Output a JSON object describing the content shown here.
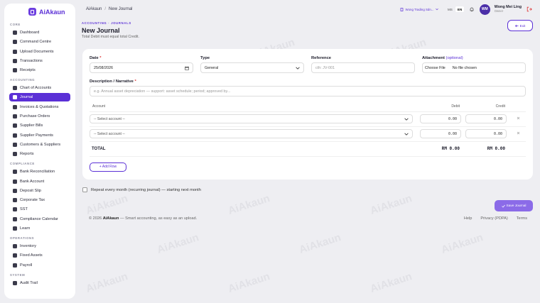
{
  "app": {
    "name": "AiAkaun",
    "watermark": "AiAkaun"
  },
  "sidebar": {
    "sections": [
      {
        "title": "CORE",
        "items": [
          {
            "label": "Dashboard",
            "icon": "dashboard-icon"
          },
          {
            "label": "Command Centre",
            "icon": "command-icon"
          },
          {
            "label": "Upload Documents",
            "icon": "upload-icon"
          },
          {
            "label": "Transactions",
            "icon": "transactions-icon"
          },
          {
            "label": "Receipts",
            "icon": "receipt-icon"
          }
        ]
      },
      {
        "title": "ACCOUNTING",
        "items": [
          {
            "label": "Chart of Accounts",
            "icon": "bar-chart-icon"
          },
          {
            "label": "Journal",
            "icon": "journal-icon",
            "active": true
          },
          {
            "label": "Invoices & Quotations",
            "icon": "invoice-icon"
          },
          {
            "label": "Purchase Orders",
            "icon": "cart-icon"
          },
          {
            "label": "Supplier Bills",
            "icon": "bill-icon"
          },
          {
            "label": "Supplier Payments",
            "icon": "payment-icon"
          },
          {
            "label": "Customers & Suppliers",
            "icon": "people-icon"
          },
          {
            "label": "Reports",
            "icon": "report-icon"
          }
        ]
      },
      {
        "title": "COMPLIANCE",
        "items": [
          {
            "label": "Bank Reconciliation",
            "icon": "check-icon"
          },
          {
            "label": "Bank Account",
            "icon": "bank-icon"
          },
          {
            "label": "Deposit Slip",
            "icon": "deposit-icon"
          },
          {
            "label": "Corporate Tax",
            "icon": "tax-icon"
          },
          {
            "label": "SST",
            "icon": "sst-icon"
          },
          {
            "label": "Compliance Calendar",
            "icon": "calendar-icon"
          },
          {
            "label": "Learn",
            "icon": "info-icon"
          }
        ]
      },
      {
        "title": "OPERATIONS",
        "items": [
          {
            "label": "Inventory",
            "icon": "box-icon"
          },
          {
            "label": "Fixed Assets",
            "icon": "asset-icon"
          },
          {
            "label": "Payroll",
            "icon": "payroll-icon"
          }
        ]
      },
      {
        "title": "SYSTEM",
        "items": [
          {
            "label": "Audit Trail",
            "icon": "audit-icon"
          }
        ]
      }
    ]
  },
  "topbar": {
    "breadcrumb_root": "AiAkaun",
    "breadcrumb_sep": "/",
    "breadcrumb_current": "New Journal",
    "company": "Wong Trading Sdn...",
    "lang_ms": "MS",
    "lang_en": "EN",
    "avatar_initials": "WM",
    "user_name": "Wong Mei Ling",
    "user_role": "Owner"
  },
  "header": {
    "eyebrow": "ACCOUNTING · JOURNALS",
    "title": "New Journal",
    "subtitle": "Total Debit must equal total Credit.",
    "exit_label": "Exit"
  },
  "form": {
    "date_label": "Date",
    "date_value": "25/08/2026",
    "type_label": "Type",
    "type_value": "General",
    "reference_label": "Reference",
    "reference_placeholder": "cth: JV-001",
    "attachment_label": "Attachment",
    "attachment_optional": "(optional)",
    "choose_file": "Choose File",
    "no_file": "No file chosen",
    "desc_label": "Description / Narrative",
    "desc_placeholder": "e.g. Annual asset depreciation — support: asset schedule; period; approved by...",
    "col_account": "Account",
    "col_debit": "Debit",
    "col_credit": "Credit",
    "rows": [
      {
        "account": "-- Select account --",
        "debit": "0.00",
        "credit": "0.00"
      },
      {
        "account": "-- Select account --",
        "debit": "0.00",
        "credit": "0.00"
      }
    ],
    "total_label": "TOTAL",
    "total_debit": "RM 0.00",
    "total_credit": "RM 0.00",
    "add_row": "+ Add Row",
    "recurring_label": "Repeat every month (recurring journal) — starting next month",
    "save_label": "Save Journal"
  },
  "footer": {
    "copyright": "© 2026",
    "brand": "AiAkaun",
    "tagline": "— Smart accounting, as easy as an upload.",
    "help": "Help",
    "privacy": "Privacy (PDPA)",
    "terms": "Terms"
  },
  "colors": {
    "accent": "#5b30d6",
    "background": "#eeeef2"
  }
}
